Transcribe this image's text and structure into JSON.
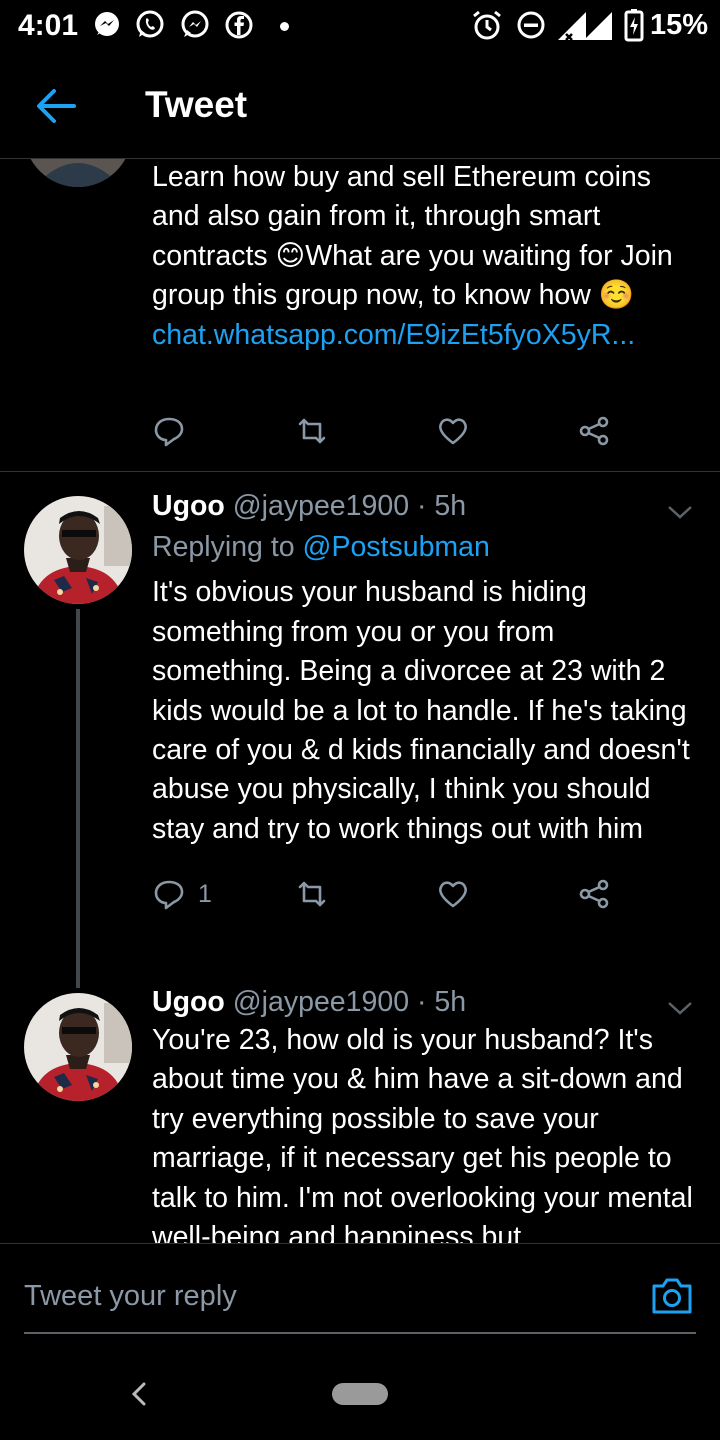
{
  "status_bar": {
    "time": "4:01",
    "notification_icons": [
      "messenger-icon",
      "whatsapp-icon",
      "messenger-icon",
      "facebook-icon"
    ],
    "network": "3G",
    "battery_percent": "15%"
  },
  "header": {
    "title": "Tweet"
  },
  "tweets": [
    {
      "text": "Learn how buy and sell Ethereum coins and also gain from it, through smart contracts 😊What are you waiting for Join group this group now, to know how ☺️",
      "link": "chat.whatsapp.com/E9izEt5fyoX5yR..."
    },
    {
      "name": "Ugoo",
      "handle": "@jaypee1900",
      "time": "· 5h",
      "replying_label": "Replying to",
      "replying_user": "@Postsubman",
      "text": "It's obvious your husband is hiding something from you or you from something. Being a divorcee at 23 with 2 kids would be a lot to handle. If he's taking care of you & d kids financially and doesn't abuse you physically, I think you should stay and try to work things out with him",
      "reply_count": "1"
    },
    {
      "name": "Ugoo",
      "handle": "@jaypee1900",
      "time": "· 5h",
      "text": "You're 23, how old is your husband? It's about time you & him have a sit-down and try everything possible to save your marriage, if it necessary get his people to talk to him. I'm not overlooking your mental well-being and happiness but"
    }
  ],
  "composer": {
    "placeholder": "Tweet your reply"
  },
  "colors": {
    "accent": "#1da1f2",
    "secondary_text": "#8b98a5",
    "divider": "#2f3336",
    "background": "#000000"
  }
}
